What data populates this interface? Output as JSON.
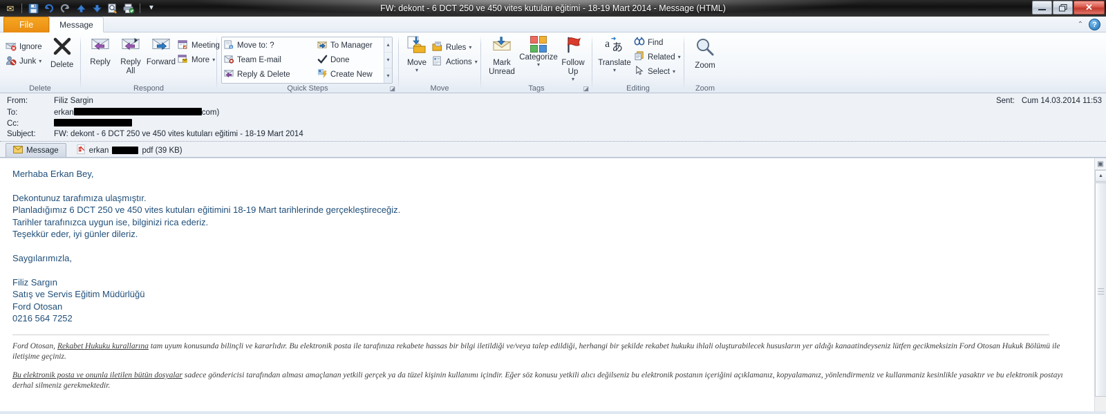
{
  "window": {
    "title": "FW: dekont - 6 DCT 250 ve 450 vites kutuları eğitimi - 18-19 Mart 2014  -  Message (HTML)",
    "minimize": "—",
    "restore": "❐",
    "close": "✕"
  },
  "quick_access": [
    {
      "name": "envelope-icon",
      "glyph": "✉"
    },
    {
      "name": "save-icon",
      "glyph": "💾"
    },
    {
      "name": "undo-icon",
      "glyph": "↺"
    },
    {
      "name": "redo-icon",
      "glyph": "↻"
    },
    {
      "name": "previous-item-icon",
      "glyph": "⬆"
    },
    {
      "name": "next-item-icon",
      "glyph": "⬇"
    },
    {
      "name": "print-preview-icon",
      "glyph": "🔍"
    },
    {
      "name": "quick-print-icon",
      "glyph": "🖨"
    },
    {
      "name": "customize-qat-icon",
      "glyph": "▾"
    }
  ],
  "tabs": {
    "file": "File",
    "message": "Message",
    "ghost": [
      "",
      "",
      "",
      ""
    ],
    "collapse_ribbon": "⌃",
    "help": "?"
  },
  "ribbon": {
    "groups": [
      {
        "label": "Delete",
        "items": [
          {
            "label": "Ignore",
            "icon": "ignore-icon",
            "glyph": "✉"
          },
          {
            "label": "Junk",
            "icon": "junk-icon",
            "glyph": "🚫",
            "caret": "▾"
          },
          {
            "label": "Delete",
            "icon": "delete-icon",
            "glyph": "✕"
          }
        ]
      },
      {
        "label": "Respond",
        "items": [
          {
            "label": "Reply",
            "icon": "reply-icon",
            "glyph": "✉"
          },
          {
            "label": "Reply\nAll",
            "icon": "reply-all-icon",
            "glyph": "✉"
          },
          {
            "label": "Forward",
            "icon": "forward-icon",
            "glyph": "✉"
          },
          {
            "label": "Meeting",
            "icon": "meeting-icon",
            "glyph": "📅"
          },
          {
            "label": "More",
            "icon": "more-icon",
            "glyph": "📅",
            "caret": "▾"
          }
        ]
      },
      {
        "label": "Quick Steps",
        "items": [
          {
            "label": "Move to: ?",
            "icon": "move-to-icon",
            "glyph": "📄"
          },
          {
            "label": "Team E-mail",
            "icon": "team-email-icon",
            "glyph": "✉"
          },
          {
            "label": "Reply & Delete",
            "icon": "reply-delete-icon",
            "glyph": "✉"
          },
          {
            "label": "To Manager",
            "icon": "to-manager-icon",
            "glyph": "✉"
          },
          {
            "label": "Done",
            "icon": "done-icon",
            "glyph": "✔"
          },
          {
            "label": "Create New",
            "icon": "create-new-icon",
            "glyph": "⚡"
          }
        ],
        "nav": [
          "▴",
          "▾",
          "▾"
        ],
        "dialog_launcher": "◪"
      },
      {
        "label": "Move",
        "items": [
          {
            "label": "Move",
            "icon": "move-icon",
            "glyph": "📁",
            "caret": "▾"
          },
          {
            "label": "Rules",
            "icon": "rules-icon",
            "glyph": "📂",
            "caret": "▾"
          },
          {
            "label": "Actions",
            "icon": "actions-icon",
            "glyph": "📋",
            "caret": "▾"
          }
        ]
      },
      {
        "label": "Tags",
        "items": [
          {
            "label": "Mark\nUnread",
            "icon": "mark-unread-icon",
            "glyph": "✉"
          },
          {
            "label": "Categorize",
            "icon": "categorize-icon",
            "glyph": "",
            "caret": "▾"
          },
          {
            "label": "Follow\nUp",
            "icon": "follow-up-icon",
            "glyph": "⚑",
            "caret": "▾"
          }
        ],
        "dialog_launcher": "◪"
      },
      {
        "label": "Editing",
        "items": [
          {
            "label": "Translate",
            "icon": "translate-icon",
            "glyph": "あ",
            "caret": "▾"
          },
          {
            "label": "Find",
            "icon": "find-icon",
            "glyph": "🔍"
          },
          {
            "label": "Related",
            "icon": "related-icon",
            "glyph": "📑",
            "caret": "▾"
          },
          {
            "label": "Select",
            "icon": "select-icon",
            "glyph": "➤",
            "caret": "▾"
          }
        ]
      },
      {
        "label": "Zoom",
        "items": [
          {
            "label": "Zoom",
            "icon": "zoom-icon",
            "glyph": "🔍"
          }
        ]
      }
    ]
  },
  "message_header": {
    "from_label": "From:",
    "from_value": "Filiz Sargin",
    "to_label": "To:",
    "to_value_prefix": "erkan",
    "to_value_suffix": "com)",
    "cc_label": "Cc:",
    "cc_value": "",
    "subject_label": "Subject:",
    "subject_value": "FW: dekont - 6 DCT 250 ve 450 vites kutuları eğitimi - 18-19 Mart 2014",
    "sent_label": "Sent:",
    "sent_value": "Cum 14.03.2014 11:53"
  },
  "attachment_bar": {
    "message_tab": "Message",
    "attachment_prefix": "erkan",
    "attachment_suffix": "pdf (39 KB)"
  },
  "body": {
    "lines": [
      "Merhaba Erkan Bey,",
      "",
      "Dekontunuz tarafımıza ulaşmıştır.",
      "Planladığımız 6 DCT 250 ve 450 vites kutuları eğitimini  18-19 Mart tarihlerinde gerçekleştireceğiz.",
      "Tarihler tarafınızca uygun ise, bilginizi rica ederiz.",
      "Teşekkür eder, iyi günler dileriz.",
      "",
      "Saygılarımızla,",
      "",
      "Filiz Sargın",
      "Satış ve Servis Eğitim Müdürlüğü",
      "Ford Otosan",
      "0216 564 7252"
    ],
    "disclaimer_1_a": "Ford Otosan, ",
    "disclaimer_1_u": "Rekabet Hukuku kurallarına",
    "disclaimer_1_b": " tam uyum konusunda bilinçli ve kararlıdır. Bu elektronik posta ile tarafınıza rekabete hassas bir bilgi iletildiği ve/veya talep edildiği, herhangi bir şekilde rekabet hukuku ihlali oluşturabilecek hususların yer aldığı kanaatindeyseniz lütfen gecikmeksizin Ford Otosan Hukuk Bölümü ile iletişime geçiniz.",
    "disclaimer_2_u": "Bu elektronik posta ve onunla iletilen bütün dosyalar",
    "disclaimer_2_b": " sadece göndericisi tarafından alması amaçlanan yetkili gerçek ya da tüzel kişinin kullanımı içindir. Eğer söz konusu yetkili alıcı değilseniz bu elektronik postanın içeriğini açıklamanız, kopyalamanız, yönlendirmeniz ve kullanmaniz kesinlikle yasaktır ve bu elektronik postayı derhal silmeniz gerekmektedir."
  },
  "scrollbar": {
    "up_arrow": "▲",
    "grip": "≡",
    "preview_pane_toggle": "▣"
  },
  "colors": {
    "body_text": "#1f4e79",
    "file_tab": "#e98c10",
    "disclaimer_text": "#3b3b3b"
  }
}
